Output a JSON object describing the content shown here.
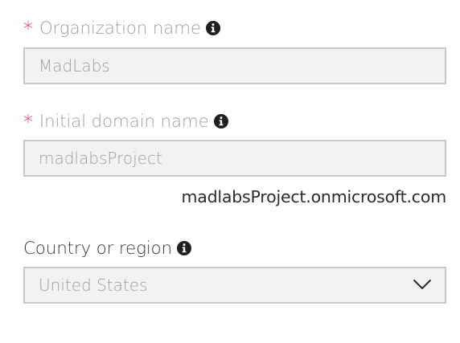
{
  "org": {
    "required_mark": "*",
    "label": "Organization name",
    "info_icon": "info-icon",
    "value": "MadLabs"
  },
  "domain": {
    "required_mark": "*",
    "label": "Initial domain name",
    "info_icon": "info-icon",
    "value": "madlabsProject",
    "full_domain": "madlabsProject.onmicrosoft.com"
  },
  "country": {
    "label": "Country or region",
    "info_icon": "info-icon",
    "selected": "United States",
    "dropdown_icon": "chevron-down-icon"
  },
  "colors": {
    "required": "#e81123",
    "disabled_text": "#9e9e9e",
    "input_bg": "#f2f2f2",
    "input_border": "#c8c8c8"
  }
}
